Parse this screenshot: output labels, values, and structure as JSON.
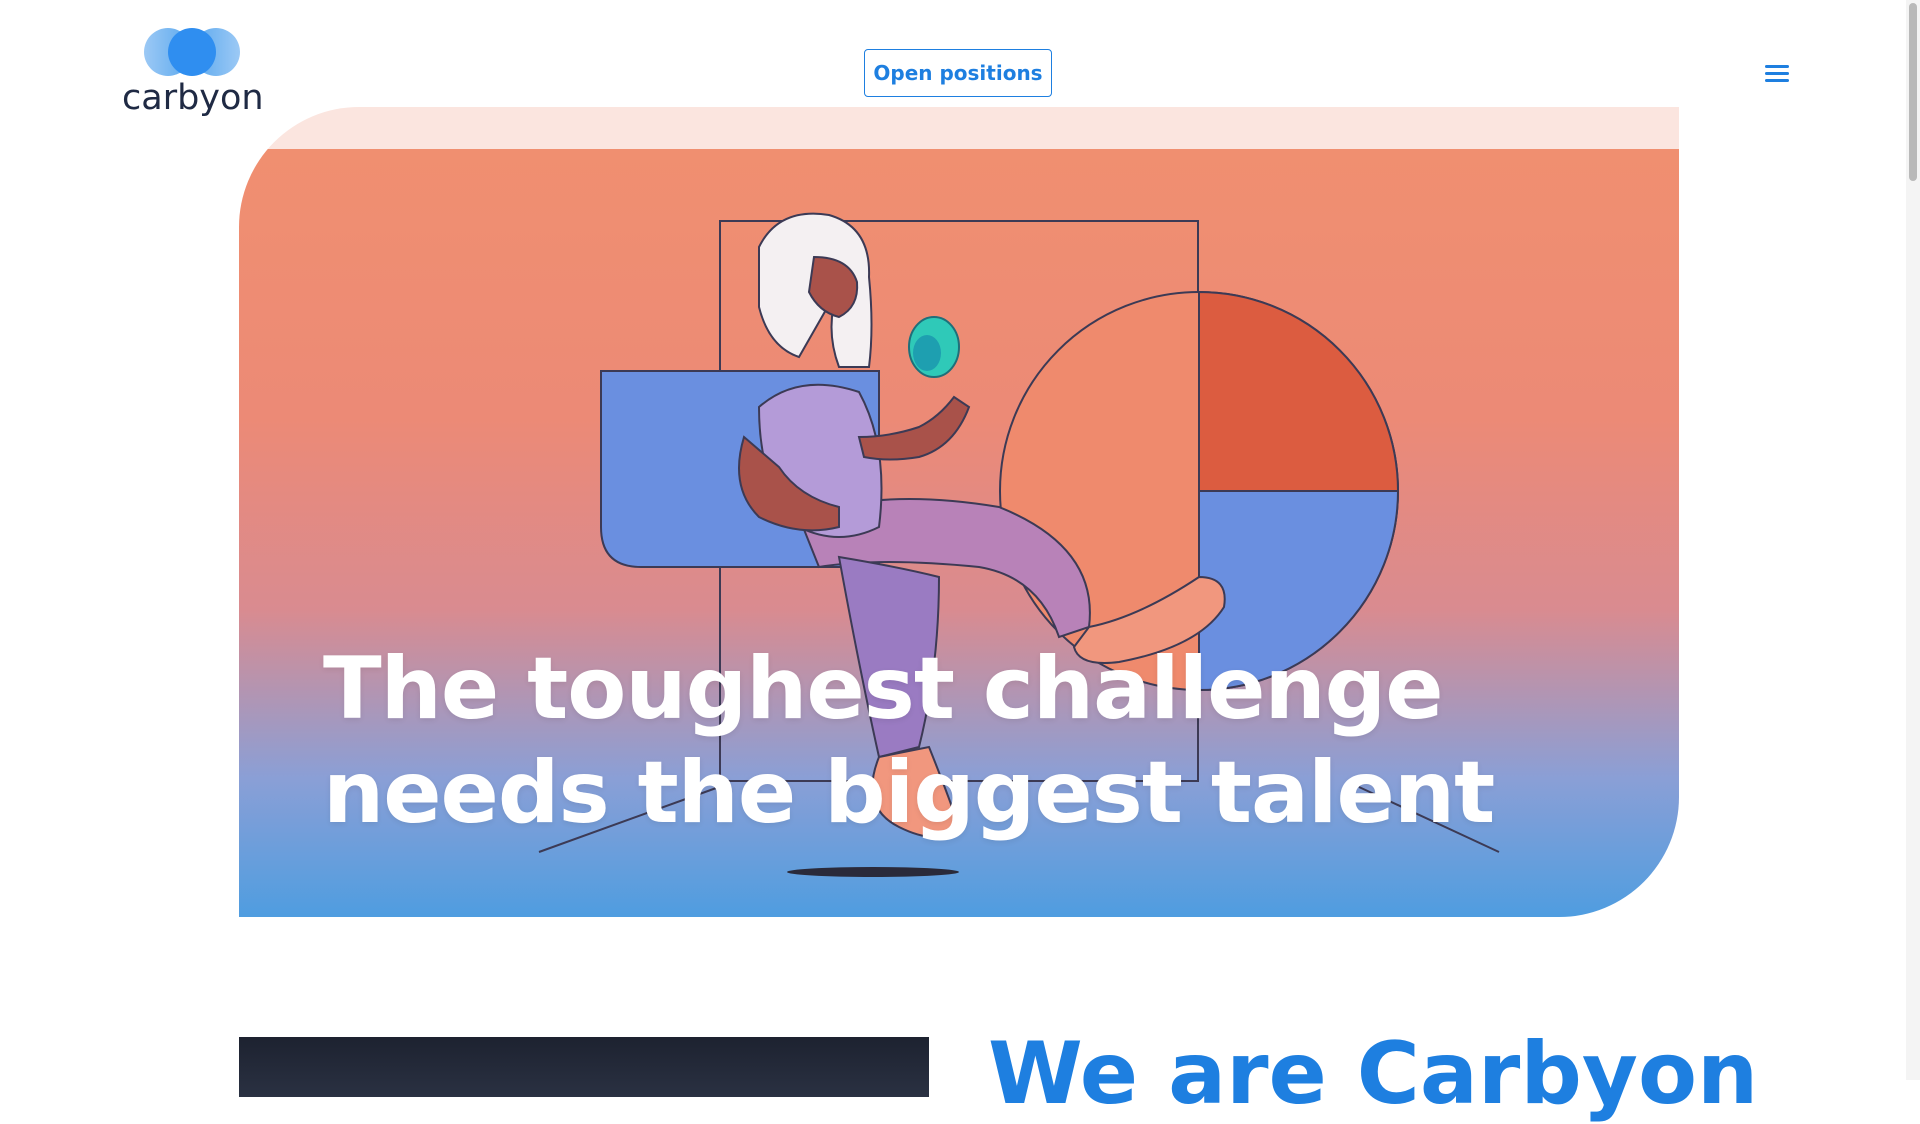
{
  "brand": {
    "name": "carbyon",
    "logo_icon": "three-circles-logo",
    "accent_color": "#1e7fe0"
  },
  "header": {
    "cta_label": "Open positions",
    "menu_icon": "hamburger-menu-icon"
  },
  "hero": {
    "title_line1": "The toughest challenge",
    "title_line2": "needs the biggest talent",
    "illustration": "woman-sitting-holding-green-crystal"
  },
  "about": {
    "heading": "We are Carbyon"
  }
}
